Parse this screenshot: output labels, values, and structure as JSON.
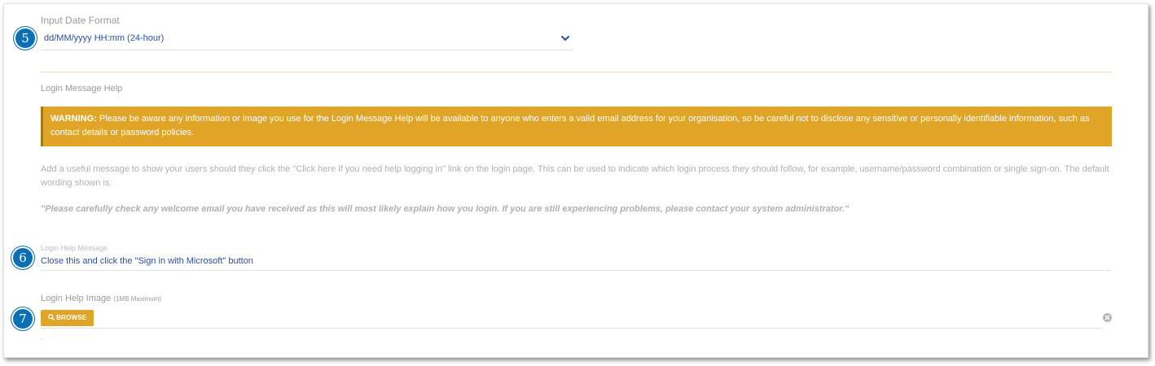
{
  "date_format": {
    "label": "Input Date Format",
    "value": "dd/MM/yyyy HH:mm (24-hour)",
    "marker": "5"
  },
  "login_help": {
    "section_label": "Login Message Help",
    "warning_bold": "WARNING:",
    "warning_text": "Please be aware any information or image you use for the Login Message Help will be available to anyone who enters a valid email address for your organisation, so be careful not to disclose any sensitive or personally identifiable information, such as contact details or password policies.",
    "description": "Add a useful message to show your users should they click the \"Click here if you need help logging in\" link on the login page. This can be used to indicate which login process they should follow, for example, username/password combination or single sign-on. The default wording shown is:",
    "default_quote": "\"Please carefully check any welcome email you have received as this will most likely explain how you login. If you are still experiencing problems, please contact your system administrator.\""
  },
  "help_message": {
    "label": "Login Help Message",
    "value": "Close this and click the \"Sign in with Microsoft\" button",
    "marker": "6"
  },
  "help_image": {
    "label": "Login Help Image",
    "label_note": "(1MB Maximum)",
    "browse_label": "BROWSE",
    "marker": "7",
    "footer_dot": "."
  },
  "colors": {
    "accent": "#e0a526",
    "link_blue": "#2b50a1",
    "badge_blue": "#0a6fb4"
  }
}
